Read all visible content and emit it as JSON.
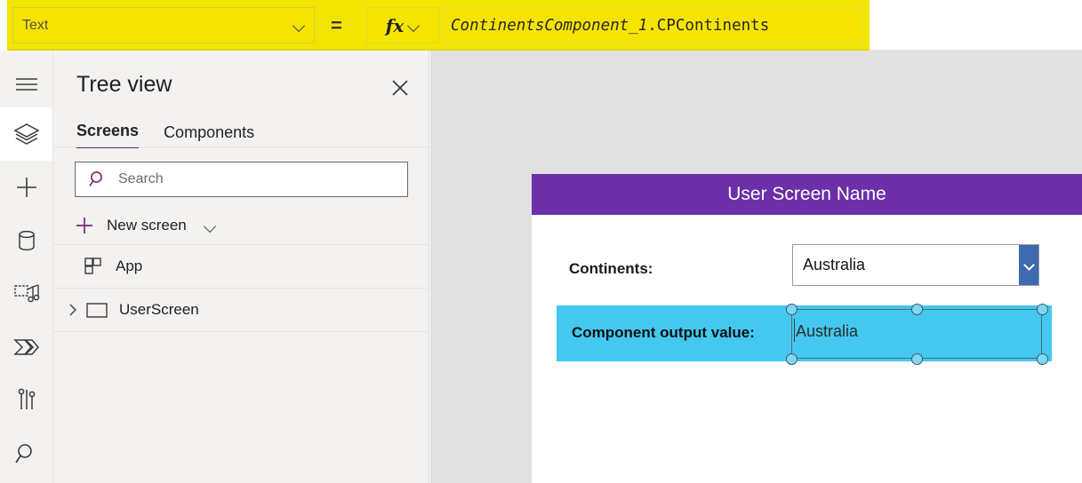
{
  "formula_bar": {
    "property_value": "Text",
    "equals_sign": "=",
    "fx_label": "fx",
    "formula_italic_part": "ContinentsComponent_1",
    "formula_plain_part": ".CPContinents",
    "highlight_color": "#f2e500"
  },
  "rail": {
    "items": [
      {
        "name": "hamburger-menu-icon",
        "label": "Menu"
      },
      {
        "name": "tree-view-icon",
        "label": "Tree view"
      },
      {
        "name": "insert-icon",
        "label": "Insert"
      },
      {
        "name": "data-icon",
        "label": "Data"
      },
      {
        "name": "media-icon",
        "label": "Media"
      },
      {
        "name": "power-automate-icon",
        "label": "Power Automate"
      },
      {
        "name": "variables-icon",
        "label": "Variables"
      },
      {
        "name": "search-rail-icon",
        "label": "Search"
      }
    ]
  },
  "tree_view": {
    "title": "Tree view",
    "close_label": "Close",
    "tabs": [
      {
        "label": "Screens",
        "active": true
      },
      {
        "label": "Components",
        "active": false
      }
    ],
    "search": {
      "placeholder": "Search",
      "value": ""
    },
    "new_screen": {
      "label": "New screen"
    },
    "items": [
      {
        "label": "App",
        "icon": "app-grid-icon",
        "expandable": false
      },
      {
        "label": "UserScreen",
        "icon": "screen-icon",
        "expandable": true
      }
    ]
  },
  "canvas": {
    "screen": {
      "header_title": "User Screen Name",
      "header_color": "#6d2fa8",
      "continents_label": "Continents:",
      "dropdown": {
        "value": "Australia",
        "accent_color": "#3f69b0"
      },
      "output": {
        "band_color": "#44c8f0",
        "label": "Component output value:",
        "selected_label_value": "Australia"
      }
    }
  }
}
